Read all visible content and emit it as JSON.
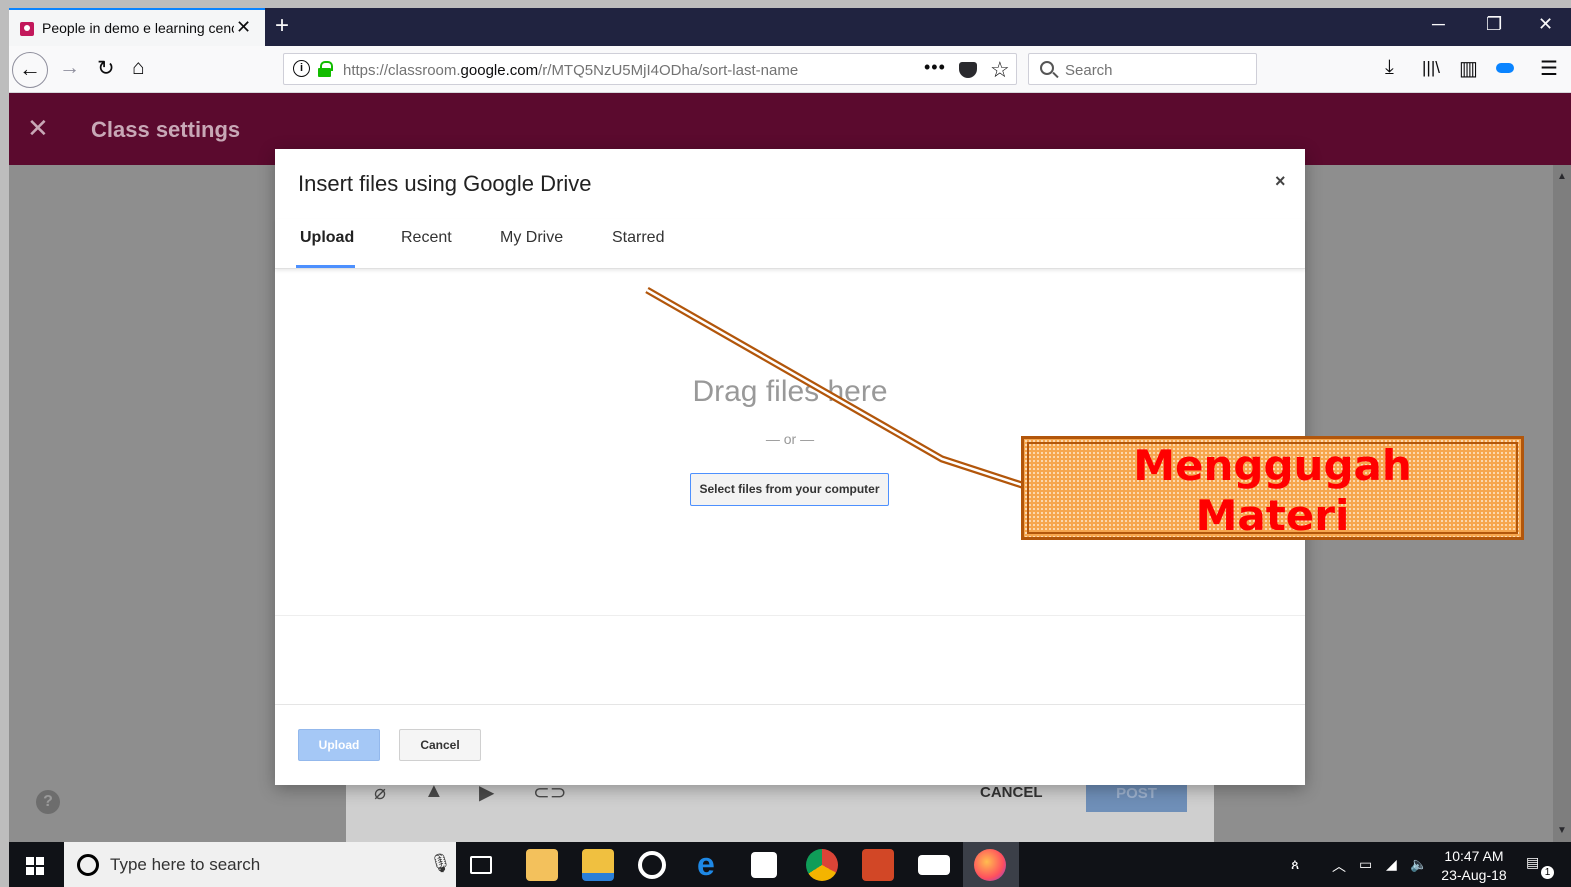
{
  "browser": {
    "tab_title": "People in demo e learning cenc",
    "url_prefix": "https://classroom.",
    "url_domain": "google.com",
    "url_path": "/r/MTQ5NzU5MjI4ODha/sort-last-name",
    "search_placeholder": "Search",
    "window_controls": {
      "minimize": "─",
      "restore": "❐",
      "close": "✕"
    },
    "accent_color": "#0a84ff"
  },
  "page": {
    "header_title": "Class settings",
    "header_close": "✕",
    "card": {
      "cancel_label": "CANCEL",
      "post_label": "POST"
    },
    "help_label": "?",
    "header_color": "#5b0a2e"
  },
  "dialog": {
    "title": "Insert files using Google Drive",
    "close_label": "×",
    "tabs": [
      {
        "label": "Upload",
        "active": true
      },
      {
        "label": "Recent",
        "active": false
      },
      {
        "label": "My Drive",
        "active": false
      },
      {
        "label": "Starred",
        "active": false
      }
    ],
    "drag_text": "Drag files here",
    "or_text": "— or —",
    "select_button": "Select files from your computer",
    "upload_button": "Upload",
    "cancel_button": "Cancel",
    "primary_color": "#4d90fe"
  },
  "callout": {
    "line1": "Menggugah",
    "line2": "Materi",
    "text_color": "#ff0000",
    "box_color": "#f6a64e",
    "border_color": "#b2560b"
  },
  "taskbar": {
    "search_placeholder": "Type here to search",
    "time": "10:47 AM",
    "date": "23-Aug-18",
    "notification_count": "1",
    "apps": [
      "task-view",
      "mail-app",
      "file-explorer",
      "media-app",
      "edge",
      "store",
      "chrome",
      "office",
      "mail",
      "firefox"
    ]
  }
}
